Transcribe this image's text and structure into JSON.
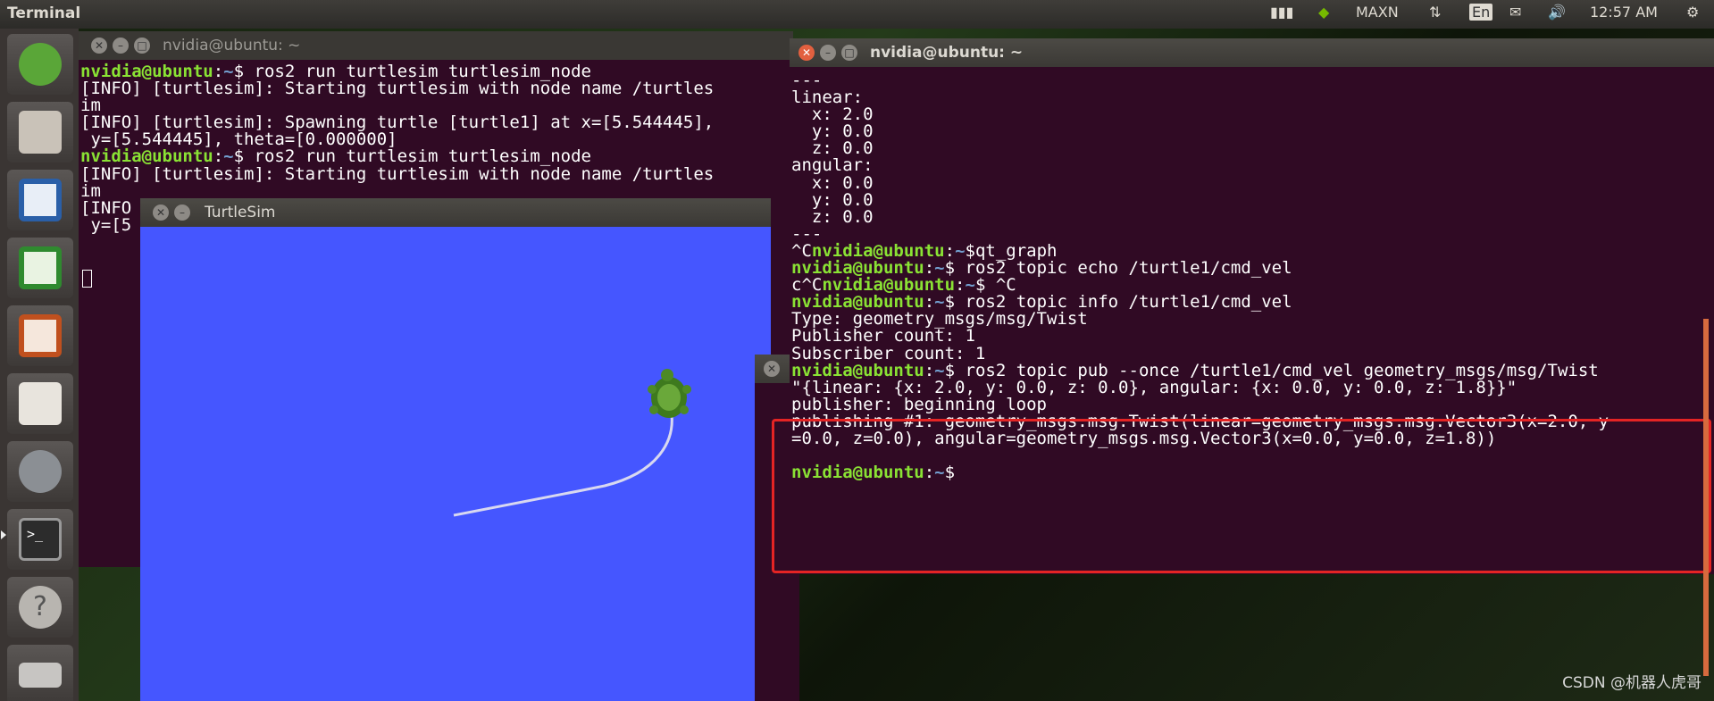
{
  "topbar": {
    "app": "Terminal",
    "maxn": "MAXN",
    "lang": "En",
    "time": "12:57 AM"
  },
  "launcher": {
    "items": [
      "ubuntu-logo-icon",
      "files-icon",
      "writer-icon",
      "calc-icon",
      "impress-icon",
      "software-center-icon",
      "settings-icon",
      "terminal-icon",
      "help-icon",
      "drive-icon"
    ]
  },
  "term1": {
    "title": "nvidia@ubuntu: ~",
    "lines": [
      [
        [
          "p",
          "nvidia@ubuntu"
        ],
        [
          "n",
          ":"
        ],
        [
          "d",
          "~"
        ],
        [
          "n",
          "$ ros2 run turtlesim turtlesim_node"
        ]
      ],
      [
        [
          "n",
          "[INFO] [turtlesim]: Starting turtlesim with node name /turtles"
        ]
      ],
      [
        [
          "n",
          "im"
        ]
      ],
      [
        [
          "n",
          "[INFO] [turtlesim]: Spawning turtle [turtle1] at x=[5.544445],"
        ]
      ],
      [
        [
          "n",
          " y=[5.544445], theta=[0.000000]"
        ]
      ],
      [
        [
          "p",
          "nvidia@ubuntu"
        ],
        [
          "n",
          ":"
        ],
        [
          "d",
          "~"
        ],
        [
          "n",
          "$ ros2 run turtlesim turtlesim_node"
        ]
      ],
      [
        [
          "n",
          "[INFO] [turtlesim]: Starting turtlesim with node name /turtles"
        ]
      ],
      [
        [
          "n",
          "im"
        ]
      ],
      [
        [
          "n",
          "[INFO"
        ]
      ],
      [
        [
          "n",
          " y=[5"
        ]
      ]
    ]
  },
  "turtlesim": {
    "title": "TurtleSim"
  },
  "term2": {
    "title": "nvidia@ubuntu: ~",
    "lines": [
      [
        [
          "n",
          "---"
        ]
      ],
      [
        [
          "n",
          "linear:"
        ]
      ],
      [
        [
          "n",
          "  x: 2.0"
        ]
      ],
      [
        [
          "n",
          "  y: 0.0"
        ]
      ],
      [
        [
          "n",
          "  z: 0.0"
        ]
      ],
      [
        [
          "n",
          "angular:"
        ]
      ],
      [
        [
          "n",
          "  x: 0.0"
        ]
      ],
      [
        [
          "n",
          "  y: 0.0"
        ]
      ],
      [
        [
          "n",
          "  z: 0.0"
        ]
      ],
      [
        [
          "n",
          "---"
        ]
      ],
      [
        [
          "n",
          "^C"
        ],
        [
          "p",
          "nvidia@ubuntu"
        ],
        [
          "n",
          ":"
        ],
        [
          "d",
          "~"
        ],
        [
          "n",
          "$qt_graph"
        ]
      ],
      [
        [
          "p",
          "nvidia@ubuntu"
        ],
        [
          "n",
          ":"
        ],
        [
          "d",
          "~"
        ],
        [
          "n",
          "$ ros2 topic echo /turtle1/cmd_vel"
        ]
      ],
      [
        [
          "n",
          "c^C"
        ],
        [
          "p",
          "nvidia@ubuntu"
        ],
        [
          "n",
          ":"
        ],
        [
          "d",
          "~"
        ],
        [
          "n",
          "$ ^C"
        ]
      ],
      [
        [
          "p",
          "nvidia@ubuntu"
        ],
        [
          "n",
          ":"
        ],
        [
          "d",
          "~"
        ],
        [
          "n",
          "$ ros2 topic info /turtle1/cmd_vel"
        ]
      ],
      [
        [
          "n",
          "Type: geometry_msgs/msg/Twist"
        ]
      ],
      [
        [
          "n",
          "Publisher count: 1"
        ]
      ],
      [
        [
          "n",
          "Subscriber count: 1"
        ]
      ],
      [
        [
          "p",
          "nvidia@ubuntu"
        ],
        [
          "n",
          ":"
        ],
        [
          "d",
          "~"
        ],
        [
          "n",
          "$ ros2 topic pub --once /turtle1/cmd_vel geometry_msgs/msg/Twist"
        ]
      ],
      [
        [
          "n",
          "\"{linear: {x: 2.0, y: 0.0, z: 0.0}, angular: {x: 0.0, y: 0.0, z: 1.8}}\""
        ]
      ],
      [
        [
          "n",
          "publisher: beginning loop"
        ]
      ],
      [
        [
          "n",
          "publishing #1: geometry_msgs.msg.Twist(linear=geometry_msgs.msg.Vector3(x=2.0, y"
        ]
      ],
      [
        [
          "n",
          "=0.0, z=0.0), angular=geometry_msgs.msg.Vector3(x=0.0, y=0.0, z=1.8))"
        ]
      ],
      [
        [
          "n",
          ""
        ]
      ],
      [
        [
          "p",
          "nvidia@ubuntu"
        ],
        [
          "n",
          ":"
        ],
        [
          "d",
          "~"
        ],
        [
          "n",
          "$ "
        ]
      ]
    ]
  },
  "watermark": "CSDN @机器人虎哥"
}
